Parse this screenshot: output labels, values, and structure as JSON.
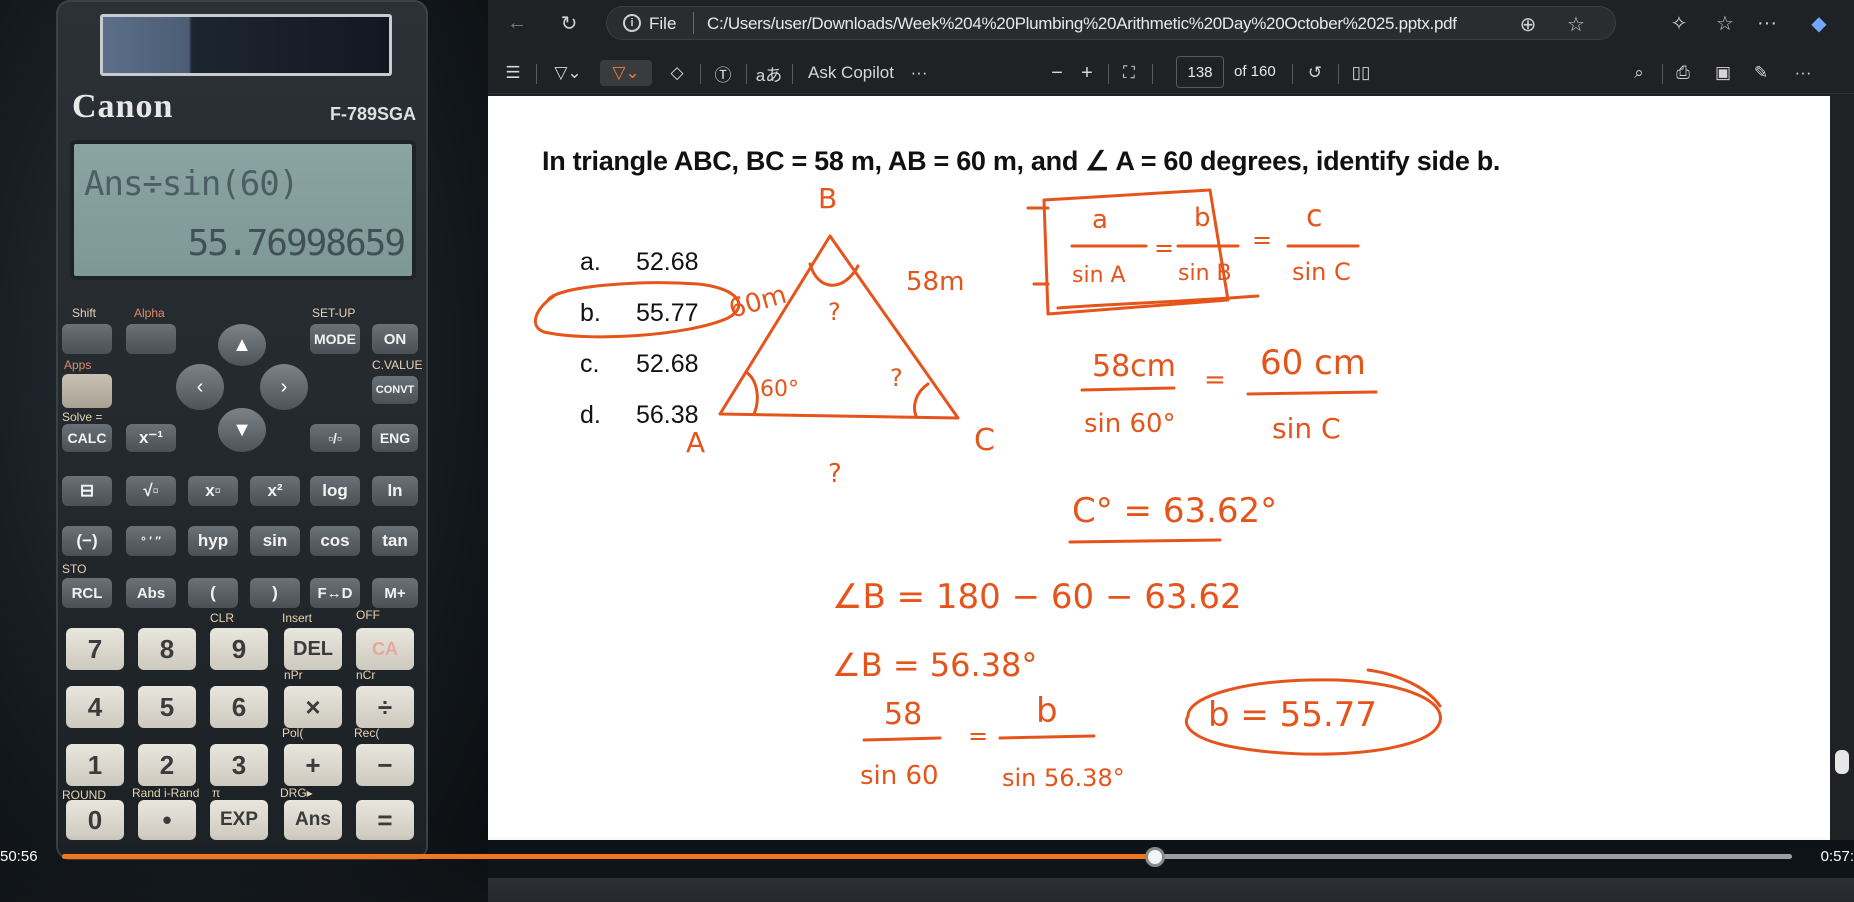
{
  "calculator": {
    "brand": "Canon",
    "model": "F-789SGA",
    "display_expression": "Ans÷sin(60)",
    "display_result": "55.76998659",
    "labels": {
      "shift": "Shift",
      "alpha": "Alpha",
      "setup": "SET-UP",
      "apps": "Apps",
      "cvalue": "C.VALUE",
      "solve": "Solve =",
      "sto": "STO",
      "clr": "CLR",
      "insert": "Insert",
      "off": "OFF",
      "npr": "nPr",
      "ncr": "nCr",
      "pol": "Pol(",
      "rec": "Rec(",
      "round": "ROUND",
      "rand": "Rand i-Rand",
      "pi": "π",
      "drg": "DRG▸"
    },
    "keys": {
      "mode": "MODE",
      "on": "ON",
      "convt": "CONVT",
      "calc": "CALC",
      "xinv": "x⁻¹",
      "frac": "▫/▫",
      "eng": "ENG",
      "fraction": "⊟",
      "sqrt": "√▫",
      "xpow": "x▫",
      "x2": "x²",
      "log": "log",
      "ln": "ln",
      "neg": "(−)",
      "dms": "° ′ ″",
      "hyp": "hyp",
      "sin": "sin",
      "cos": "cos",
      "tan": "tan",
      "rcl": "RCL",
      "abs": "Abs",
      "lparen": "(",
      "rparen": ")",
      "fd": "F↔D",
      "mplus": "M+",
      "k7": "7",
      "k8": "8",
      "k9": "9",
      "del": "DEL",
      "ac": "CA",
      "k4": "4",
      "k5": "5",
      "k6": "6",
      "times": "×",
      "div": "÷",
      "k1": "1",
      "k2": "2",
      "k3": "3",
      "plus": "+",
      "minus": "−",
      "k0": "0",
      "dot": "•",
      "exp": "EXP",
      "ans": "Ans",
      "eq": "="
    }
  },
  "browser": {
    "address_file_label": "File",
    "address_url": "C:/Users/user/Downloads/Week%204%20Plumbing%20Arithmetic%20Day%20October%2025.pptx.pdf",
    "toolbar": {
      "ask_copilot": "Ask Copilot",
      "read_aloud": "aあ",
      "more": "···",
      "zoom_out": "−",
      "zoom_in": "+",
      "page_number": "138",
      "page_total": "of 160"
    }
  },
  "slide": {
    "question": "In triangle ABC, BC = 58 m, AB = 60 m, and ∠ A = 60 degrees, identify side b.",
    "options": [
      {
        "letter": "a.",
        "value": "52.68"
      },
      {
        "letter": "b.",
        "value": "55.77"
      },
      {
        "letter": "c.",
        "value": "52.68"
      },
      {
        "letter": "d.",
        "value": "56.38"
      }
    ],
    "ink": {
      "color": "#e5541b",
      "vertex_b": "B",
      "vertex_a": "A",
      "vertex_c": "C",
      "side_ab": "60m",
      "side_bc": "58m",
      "angle_a": "60°",
      "unknown_mark": "?",
      "law_a_num": "a",
      "law_a_den": "sin A",
      "law_b_num": "b",
      "law_b_den": "sin B",
      "law_c_num": "c",
      "law_c_den": "sin C",
      "eq_sign": "=",
      "step1_left_num": "58cm",
      "step1_left_den": "sin 60°",
      "step1_right_num": "60 cm",
      "step1_right_den": "sin C",
      "result_c": "C° = 63.62°",
      "angle_b_expr": "∠B = 180 − 60 − 63.62",
      "angle_b_result": "∠B = 56.38°",
      "final_left_num": "58",
      "final_left_den": "sin 60",
      "final_right_num": "b",
      "final_right_den": "sin 56.38°",
      "final_answer": "b = 55.77"
    }
  },
  "player": {
    "elapsed": "50:56",
    "duration": "0:57:",
    "progress": 0.632
  }
}
